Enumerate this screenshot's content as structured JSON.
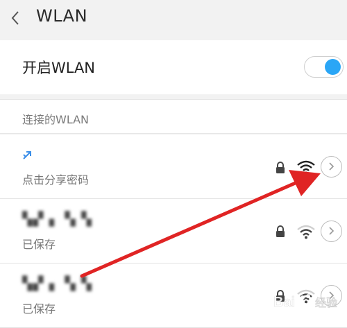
{
  "header": {
    "title": "WLAN",
    "back_icon": "chevron-left-icon"
  },
  "wlan_toggle": {
    "label": "开启WLAN",
    "state": "on",
    "color": "#2aa6f6"
  },
  "connected_section": {
    "title": "连接的WLAN"
  },
  "networks": [
    {
      "name": "",
      "status": "点击分享密码",
      "secured": true,
      "signal": "full",
      "connected": true
    },
    {
      "name": "[blurred]",
      "status": "已保存",
      "secured": true,
      "signal": "medium",
      "connected": false
    },
    {
      "name": "[blurred]",
      "status": "已保存",
      "secured": true,
      "signal": "medium",
      "connected": false
    }
  ],
  "annotation": {
    "arrow_color": "#e02424"
  },
  "watermark": {
    "text": "Bai经验"
  }
}
